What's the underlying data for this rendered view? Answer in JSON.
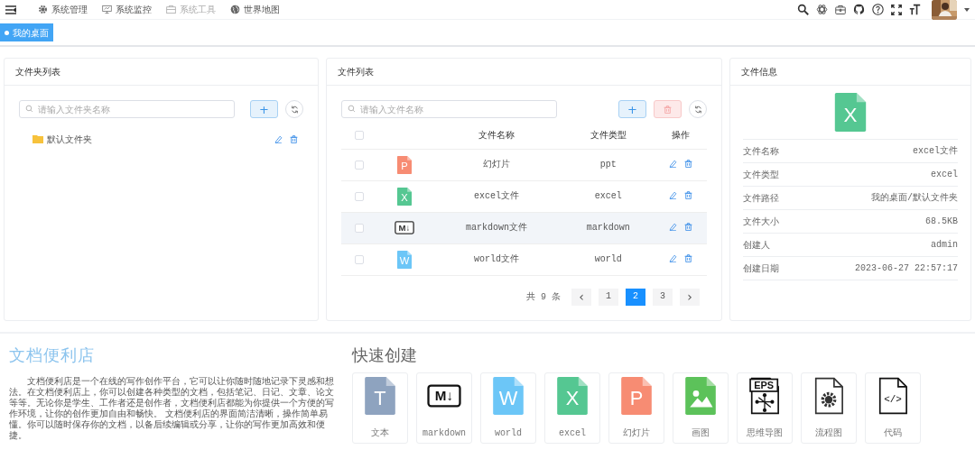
{
  "top_menu": [
    {
      "label": "系统管理",
      "dim": false
    },
    {
      "label": "系统监控",
      "dim": false
    },
    {
      "label": "系统工具",
      "dim": true
    },
    {
      "label": "世界地图",
      "dim": false
    }
  ],
  "tags": [
    {
      "label": "我的桌面",
      "selected": true
    }
  ],
  "folder_panel": {
    "title": "文件夹列表",
    "search": {
      "placeholder": "请输入文件夹名称"
    },
    "add_label": "+",
    "folders": [
      {
        "name": "默认文件夹"
      }
    ]
  },
  "file_panel": {
    "title": "文件列表",
    "search": {
      "placeholder": "请输入文件名称"
    },
    "add_label": "+",
    "all_checked": false,
    "columns": [
      "文件名称",
      "文件类型",
      "操作"
    ],
    "rows": [
      {
        "checked": false,
        "highlighted": false,
        "icon": {
          "kind": "doc",
          "glyph": "P",
          "color": "#f78c73"
        },
        "name": "幻灯片",
        "type": "ppt"
      },
      {
        "checked": false,
        "highlighted": false,
        "icon": {
          "kind": "doc",
          "glyph": "X",
          "color": "#55c792"
        },
        "name": "excel文件",
        "type": "excel"
      },
      {
        "checked": false,
        "highlighted": true,
        "icon": {
          "kind": "markdown",
          "glyph": "M↓",
          "color": "#333333"
        },
        "name": "markdown文件",
        "type": "markdown"
      },
      {
        "checked": false,
        "highlighted": false,
        "icon": {
          "kind": "doc",
          "glyph": "W",
          "color": "#6cc6f7"
        },
        "name": "world文件",
        "type": "world"
      }
    ],
    "total": "共 9 条",
    "prev": "‹",
    "next": "›",
    "pages": [
      {
        "label": "1",
        "selected": false
      },
      {
        "label": "2",
        "selected": true
      },
      {
        "label": "3",
        "selected": false
      }
    ]
  },
  "info_panel": {
    "title": "文件信息",
    "icon": {
      "kind": "doc",
      "glyph": "X",
      "color": "#55c792"
    },
    "fields": [
      {
        "label": "文件名称",
        "value": "excel文件"
      },
      {
        "label": "文件类型",
        "value": "excel"
      },
      {
        "label": "文件路径",
        "value": "我的桌面/默认文件夹"
      },
      {
        "label": "文件大小",
        "value": "68.5KB"
      },
      {
        "label": "创建人",
        "value": "admin"
      },
      {
        "label": "创建日期",
        "value": "2023-06-27 22:57:17"
      }
    ]
  },
  "intro": {
    "title": "文档便利店",
    "text": "文档便利店是一个在线的写作创作平台，它可以让你随时随地记录下灵感和想法。在文档便利店上，你可以创建各种类型的文档，包括笔记、日记、文章、论文等等。无论你是学生、工作者还是创作者，文档便利店都能为你提供一个方便的写作环境，让你的创作更加自由和畅快。 文档便利店的界面简洁清晰，操作简单易懂。你可以随时保存你的文档，以备后续编辑或分享，让你的写作更加高效和便捷。"
  },
  "quick_create": {
    "title": "快速创建",
    "items": [
      {
        "label": "文本",
        "icon": {
          "kind": "doc",
          "glyph": "T",
          "color": "#8ea3bf"
        }
      },
      {
        "label": "markdown",
        "icon": {
          "kind": "markdown",
          "glyph": "M↓",
          "color": "#111111"
        }
      },
      {
        "label": "world",
        "icon": {
          "kind": "doc",
          "glyph": "W",
          "color": "#6cc6f7"
        }
      },
      {
        "label": "excel",
        "icon": {
          "kind": "doc",
          "glyph": "X",
          "color": "#55c792"
        }
      },
      {
        "label": "幻灯片",
        "icon": {
          "kind": "doc",
          "glyph": "P",
          "color": "#f78c73"
        }
      },
      {
        "label": "画图"
      },
      {
        "label": "思维导图",
        "icon": {
          "kind": "eps",
          "glyph": "EPS",
          "color": "#111111"
        }
      },
      {
        "label": "流程图",
        "icon": {
          "kind": "gear",
          "color": "#333333"
        }
      },
      {
        "label": "代码",
        "icon": {
          "kind": "code",
          "glyph": "</>",
          "color": "#111111"
        }
      }
    ]
  }
}
